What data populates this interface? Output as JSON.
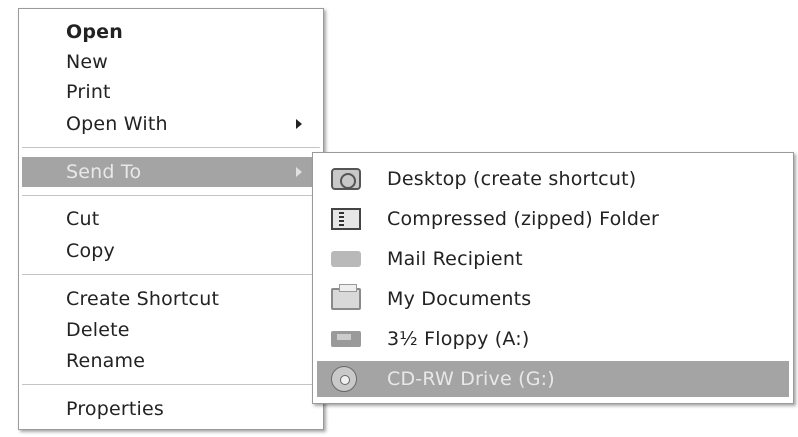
{
  "context_menu": {
    "items": [
      {
        "label": "Open"
      },
      {
        "label": "New"
      },
      {
        "label": "Print"
      },
      {
        "label": "Open With"
      },
      {
        "label": "Send To"
      },
      {
        "label": "Cut"
      },
      {
        "label": "Copy"
      },
      {
        "label": "Create Shortcut"
      },
      {
        "label": "Delete"
      },
      {
        "label": "Rename"
      },
      {
        "label": "Properties"
      }
    ]
  },
  "send_to_menu": {
    "items": [
      {
        "label": "Desktop (create shortcut)",
        "icon": "desktop-icon"
      },
      {
        "label": "Compressed (zipped) Folder",
        "icon": "zip-folder-icon"
      },
      {
        "label": "Mail Recipient",
        "icon": "mail-icon"
      },
      {
        "label": "My Documents",
        "icon": "my-documents-icon"
      },
      {
        "label": "3½ Floppy (A:)",
        "icon": "floppy-drive-icon"
      },
      {
        "label": "CD-RW Drive (G:)",
        "icon": "cd-drive-icon"
      }
    ]
  },
  "colors": {
    "highlight": "#a4a4a4",
    "highlight_text": "#e8e8e8",
    "menu_border": "#9a9a9a",
    "separator": "#c4c4c4"
  }
}
